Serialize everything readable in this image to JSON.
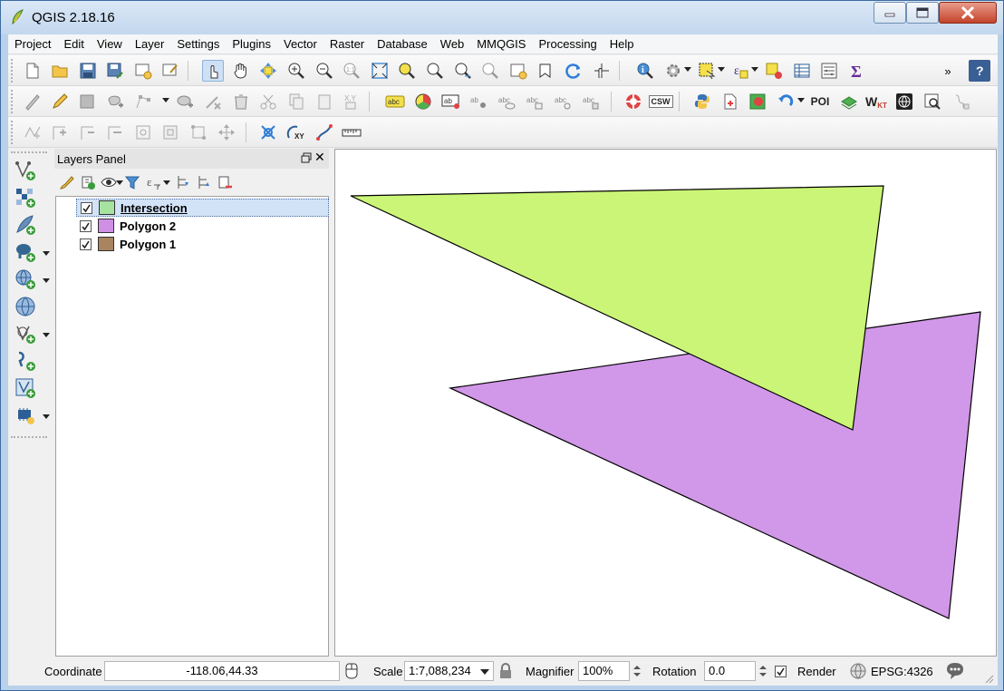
{
  "window": {
    "title": "QGIS 2.18.16"
  },
  "menubar": {
    "items": [
      "Project",
      "Edit",
      "View",
      "Layer",
      "Settings",
      "Plugins",
      "Vector",
      "Raster",
      "Database",
      "Web",
      "MMQGIS",
      "Processing",
      "Help"
    ]
  },
  "toolbars": {
    "overflow": "»",
    "text_buttons": {
      "csw": "CSW",
      "poi": "POI",
      "wkt_w": "W",
      "wkt_kt": "KT",
      "xy": "XY"
    }
  },
  "layers_panel": {
    "title": "Layers Panel",
    "float_icon": "float-icon",
    "close_label": "✕",
    "layers": [
      {
        "name": "Intersection",
        "checked": true,
        "selected": true,
        "color": "#a6e3a1"
      },
      {
        "name": "Polygon 2",
        "checked": true,
        "selected": false,
        "color": "#cf8fe3"
      },
      {
        "name": "Polygon 1",
        "checked": true,
        "selected": false,
        "color": "#a9845f"
      }
    ]
  },
  "map": {
    "polygon_green_color": "#cbf577",
    "polygon_purple_color": "#d197e8",
    "outline_color": "#000000"
  },
  "statusbar": {
    "coordinate_label": "Coordinate",
    "coordinate_value": "-118.06,44.33",
    "scale_label": "Scale",
    "scale_value": "1:7,088,234",
    "magnifier_label": "Magnifier",
    "magnifier_value": "100%",
    "rotation_label": "Rotation",
    "rotation_value": "0.0",
    "render_label": "Render",
    "render_checked": true,
    "crs_label": "EPSG:4326"
  }
}
